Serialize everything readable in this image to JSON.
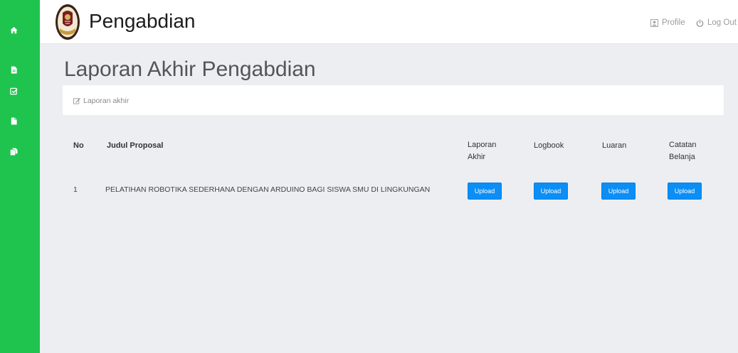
{
  "app": {
    "title": "Pengabdian",
    "logo_icon": "university-seal-logo"
  },
  "header": {
    "profile": {
      "icon": "user-icon",
      "label": "Profile"
    },
    "logout": {
      "icon": "power-icon",
      "label": "Log Out"
    }
  },
  "sidebar": {
    "items": [
      {
        "icon": "home-icon"
      },
      {
        "icon": "file-text-icon"
      },
      {
        "icon": "check-square-icon"
      },
      {
        "icon": "file-icon"
      },
      {
        "icon": "copy-icon"
      }
    ]
  },
  "page": {
    "title": "Laporan Akhir Pengabdian"
  },
  "breadcrumb": {
    "icon": "edit-icon",
    "label": "Laporan akhir"
  },
  "table": {
    "columns": [
      "No",
      "Judul Proposal",
      "Laporan Akhir",
      "Logbook",
      "Luaran",
      "Catatan Belanja"
    ],
    "rows": [
      {
        "no": "1",
        "title": "PELATIHAN ROBOTIKA SEDERHANA DENGAN ARDUINO BAGI SISWA SMU DI LINGKUNGAN",
        "actions": [
          "Upload",
          "Upload",
          "Upload",
          "Upload"
        ]
      }
    ]
  },
  "colors": {
    "sidebar": "#1fc44e",
    "accent": "#0b8ef5",
    "background": "#eceef2",
    "header": "#ffffff"
  }
}
